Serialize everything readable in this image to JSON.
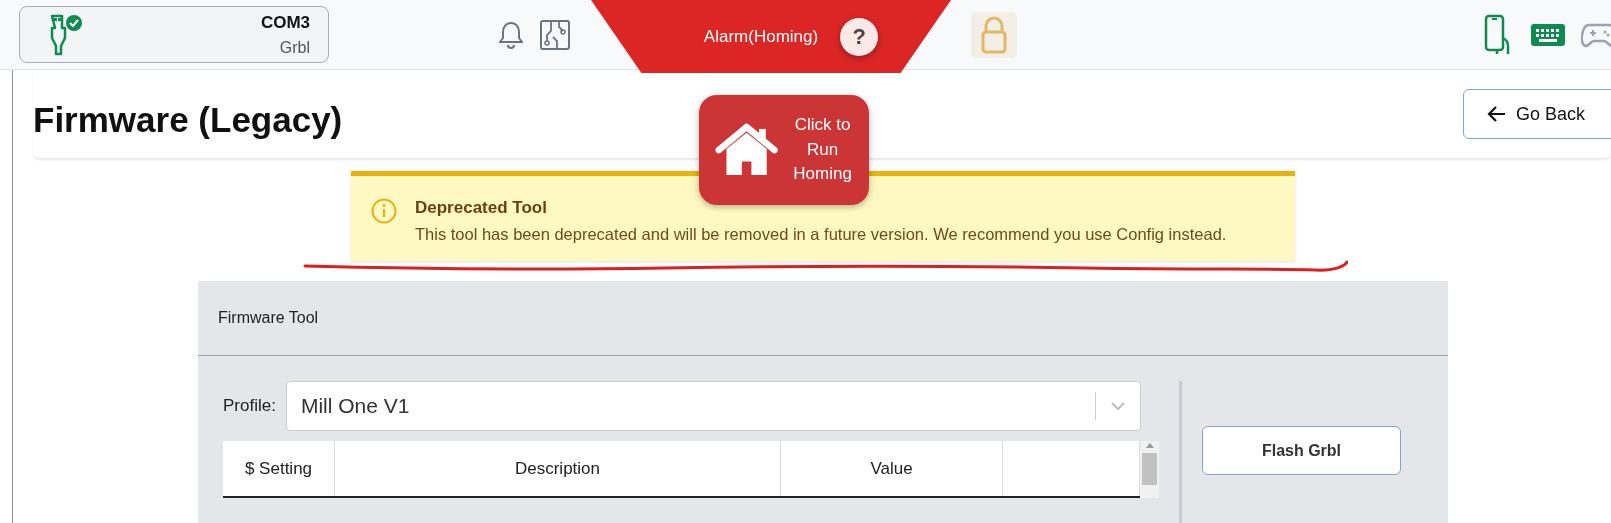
{
  "connection": {
    "port": "COM3",
    "firmware": "Grbl",
    "connected": true
  },
  "alarm": {
    "text": "Alarm(Homing)",
    "help": "?"
  },
  "page": {
    "title": "Firmware (Legacy)",
    "back_button": "Go Back"
  },
  "homing_button": {
    "label": "Click to Run Homing"
  },
  "alert": {
    "title": "Deprecated Tool",
    "message": "This tool has been deprecated and will be removed in a future version. We recommend you use Config instead."
  },
  "panel": {
    "title": "Firmware Tool",
    "profile": {
      "label": "Profile:",
      "value": "Mill One V1"
    },
    "flash_button": "Flash Grbl",
    "table": {
      "columns": [
        "$ Setting",
        "Description",
        "Value"
      ]
    }
  }
}
